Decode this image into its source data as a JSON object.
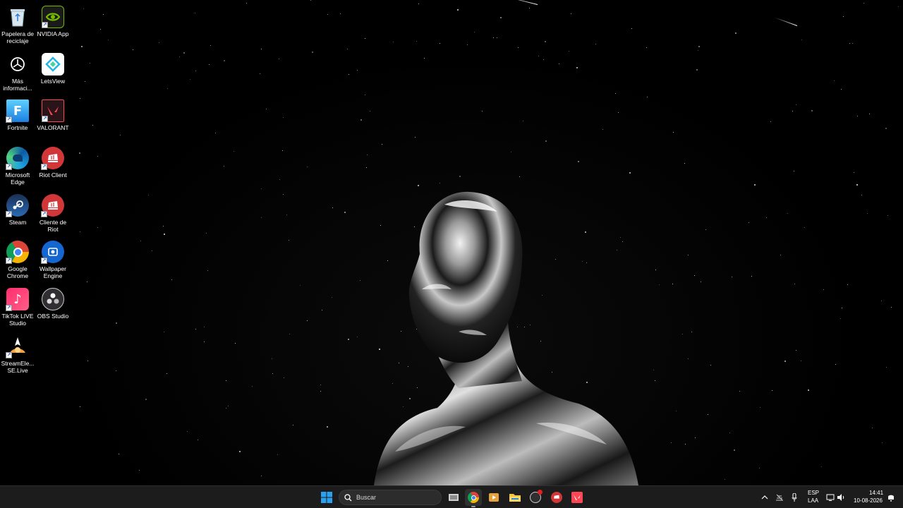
{
  "desktop": {
    "icons": [
      {
        "label": "Papelera de reciclaje",
        "icon": "recycle-bin-icon"
      },
      {
        "label": "NVIDIA App",
        "icon": "nvidia-icon"
      },
      {
        "label": "Más informaci...",
        "icon": "info-icon"
      },
      {
        "label": "LetsView",
        "icon": "letsview-icon"
      },
      {
        "label": "Fortnite",
        "icon": "fortnite-icon"
      },
      {
        "label": "VALORANT",
        "icon": "valorant-icon"
      },
      {
        "label": "Microsoft Edge",
        "icon": "edge-icon"
      },
      {
        "label": "Riot Client",
        "icon": "riot-client-icon"
      },
      {
        "label": "Steam",
        "icon": "steam-icon"
      },
      {
        "label": "Cliente de Riot",
        "icon": "riot-client-icon"
      },
      {
        "label": "Google Chrome",
        "icon": "chrome-icon"
      },
      {
        "label": "Wallpaper Engine",
        "icon": "wallpaper-engine-icon"
      },
      {
        "label": "TikTok LIVE Studio",
        "icon": "tiktok-icon"
      },
      {
        "label": "OBS Studio",
        "icon": "obs-icon"
      },
      {
        "label": "StreamEle... SE.Live",
        "icon": "streamelements-icon"
      }
    ]
  },
  "taskbar": {
    "search_placeholder": "Buscar",
    "apps": [
      {
        "name": "task-view",
        "icon": "task-view-icon"
      },
      {
        "name": "chrome",
        "icon": "chrome-icon",
        "active": true
      },
      {
        "name": "media-player",
        "icon": "media-player-icon"
      },
      {
        "name": "file-explorer",
        "icon": "folder-icon"
      },
      {
        "name": "obs",
        "icon": "obs-icon"
      },
      {
        "name": "riot-client",
        "icon": "riot-client-icon"
      },
      {
        "name": "valorant",
        "icon": "valorant-icon"
      }
    ],
    "tray": {
      "language": "ESP",
      "layout": "LAA",
      "time": "14:41",
      "date": "10-08-2026"
    }
  },
  "colors": {
    "taskbar_bg": "#1c1c1c",
    "search_bg": "#2c2c2c",
    "riot_red": "#d13639",
    "windows_blue": "#2aa0f0"
  }
}
